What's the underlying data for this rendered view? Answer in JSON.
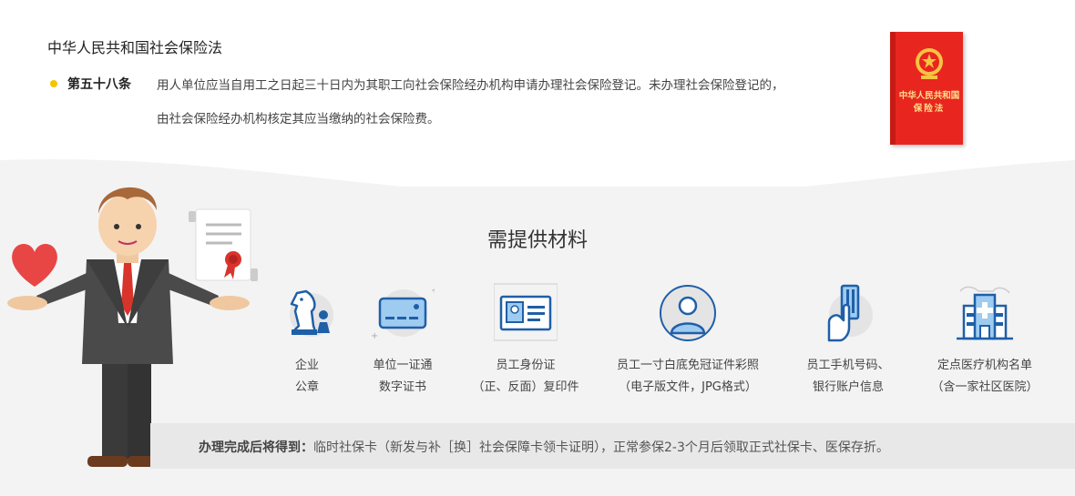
{
  "law": {
    "title": "中华人民共和国社会保险法",
    "article_no": "第五十八条",
    "article_line1": "用人单位应当自用工之日起三十日内为其职工向社会保险经办机构申请办理社会保险登记。未办理社会保险登记的，",
    "article_line2": "由社会保险经办机构核定其应当缴纳的社会保险费。"
  },
  "book": {
    "title_line1": "中华人民共和国",
    "title_line2": "保险法"
  },
  "section": {
    "title": "需提供材料"
  },
  "materials": [
    {
      "line1": "企业",
      "line2": "公章",
      "icon": "chess-knight-icon"
    },
    {
      "line1": "单位一证通",
      "line2": "数字证书",
      "icon": "card-icon"
    },
    {
      "line1": "员工身份证",
      "line2": "（正、反面）复印件",
      "icon": "id-card-icon"
    },
    {
      "line1": "员工一寸白底免冠证件彩照",
      "line2": "（电子版文件，JPG格式）",
      "icon": "portrait-icon"
    },
    {
      "line1": "员工手机号码、",
      "line2": "银行账户信息",
      "icon": "phone-card-icon"
    },
    {
      "line1": "定点医疗机构名单",
      "line2": "（含一家社区医院）",
      "icon": "hospital-icon"
    }
  ],
  "result": {
    "label": "办理完成后将得到：",
    "text": "临时社保卡（新发与补［换］社会保障卡领卡证明），正常参保2-3个月后领取正式社保卡、医保存折。"
  },
  "colors": {
    "accent_blue": "#1f5fa8",
    "dot_yellow": "#f5c400",
    "book_red": "#e8261f"
  }
}
